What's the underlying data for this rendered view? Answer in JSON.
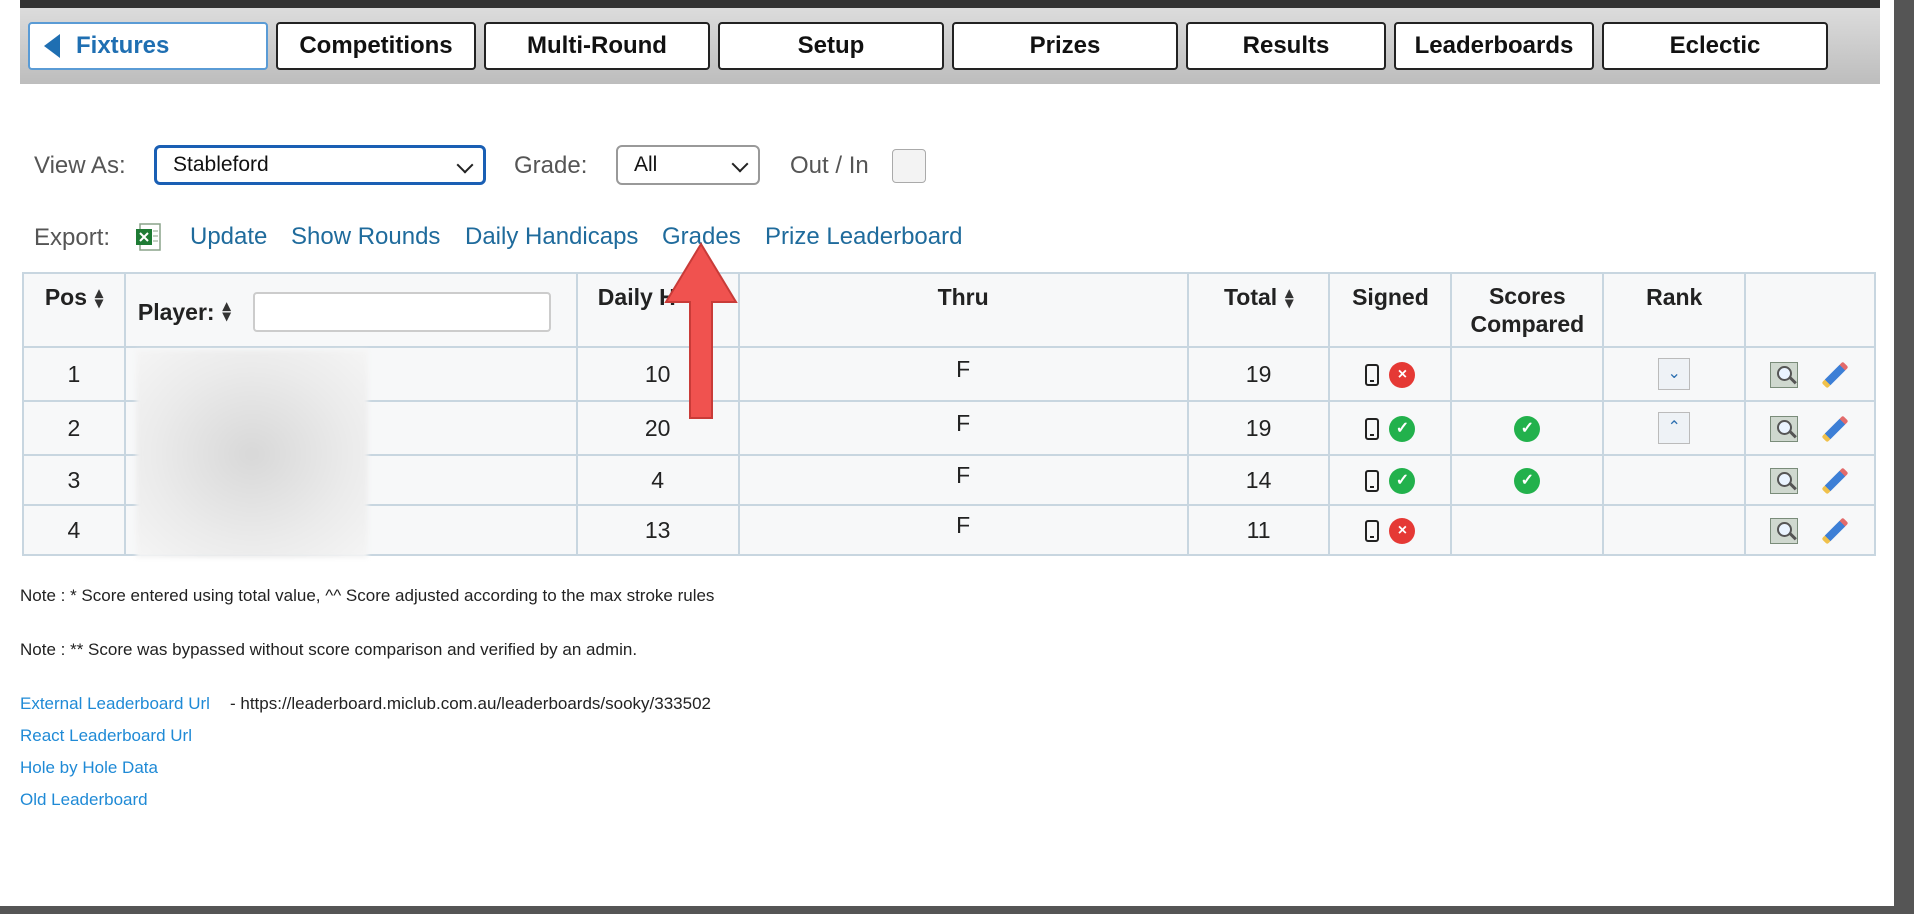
{
  "nav": {
    "tabs": [
      "Fixtures",
      "Competitions",
      "Multi-Round",
      "Setup",
      "Prizes",
      "Results",
      "Leaderboards",
      "Eclectic"
    ]
  },
  "filters": {
    "view_as_label": "View As:",
    "view_as_value": "Stableford",
    "grade_label": "Grade:",
    "grade_value": "All",
    "out_in_label": "Out / In"
  },
  "export": {
    "label": "Export:",
    "links": [
      "Update",
      "Show Rounds",
      "Daily Handicaps",
      "Grades",
      "Prize Leaderboard"
    ]
  },
  "table": {
    "headers": {
      "pos": "Pos",
      "player": "Player:",
      "daily": "Daily H",
      "thru": "Thru",
      "total": "Total",
      "signed": "Signed",
      "scores_compared": "Scores Compared",
      "rank": "Rank"
    },
    "rows": [
      {
        "pos": "1",
        "daily": "10",
        "thru": "F",
        "total": "19",
        "signed": "no",
        "compared": "",
        "rank": "down"
      },
      {
        "pos": "2",
        "daily": "20",
        "thru": "F",
        "total": "19",
        "signed": "yes",
        "compared": "yes",
        "rank": "up"
      },
      {
        "pos": "3",
        "daily": "4",
        "thru": "F",
        "total": "14",
        "signed": "yes",
        "compared": "yes",
        "rank": ""
      },
      {
        "pos": "4",
        "daily": "13",
        "thru": "F",
        "total": "11",
        "signed": "no",
        "compared": "",
        "rank": ""
      }
    ]
  },
  "notes": {
    "note1": "Note : * Score entered using total value, ^^ Score adjusted according to the max stroke rules",
    "note2": "Note : ** Score was bypassed without score comparison and verified by an admin."
  },
  "footer": {
    "external_link": "External Leaderboard Url",
    "external_url_text": "- https://leaderboard.miclub.com.au/leaderboards/sooky/333502",
    "react_link": "React Leaderboard Url",
    "hole_link": "Hole by Hole Data",
    "old_link": "Old Leaderboard"
  },
  "colors": {
    "accent": "#1f6fb2",
    "link": "#1f6b9c",
    "arrow": "#f0524f",
    "error": "#e53935",
    "success": "#22b14c"
  }
}
